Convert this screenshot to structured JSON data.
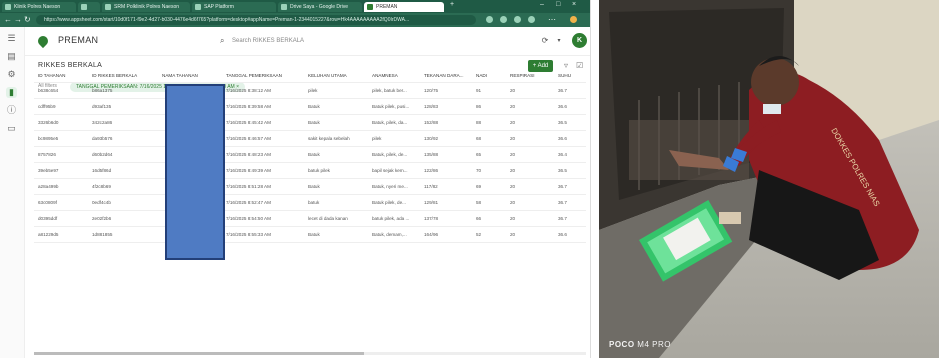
{
  "browser": {
    "tabs": [
      {
        "label": "Klinik Polres Naeson"
      },
      {
        "label": ""
      },
      {
        "label": "SRM Polklinik Polres Naeson"
      },
      {
        "label": "SAP Platform"
      },
      {
        "label": "Drive Saya - Google Drive"
      },
      {
        "label": "PREMAN"
      }
    ],
    "url": "https://www.appsheet.com/start/10d0f171-f9e2-4d27-b030-4476e4d6f765?platform=desktop#appName=Preman-1-2344015227&row=Hk4AAAAAAAAA2fQ0IrDWA...",
    "add_tab": "+",
    "win_controls": [
      "–",
      "□",
      "×"
    ]
  },
  "app": {
    "name": "PREMAN",
    "search_placeholder": "Search RIKKES BERKALA",
    "avatar_initial": "K",
    "page_title": "RIKKES BERKALA",
    "add_label": "+ Add",
    "all_filters": "All filters",
    "filter_chip": "TANGGAL PEMERIKSAAN: 7/16/2025 12:00 AM – 7/17/2025 12:00 AM  ×",
    "columns": [
      "ID TAHANAN",
      "ID RIKKES BERKALA",
      "NAMA TAHANAN",
      "TANGGAL PEMERIKSAAN",
      "KELUHAN UTAMA",
      "ANAMNESA",
      "TEKANAN DARA...",
      "NADI",
      "RESPIRASI",
      "SUHU"
    ],
    "rows": [
      [
        "b638c654",
        "b86a1375",
        "",
        "7/16/2025 8:38:12 AM",
        "pilek",
        "pilek, batuk ber...",
        "120/75",
        "91",
        "20",
        "36.7"
      ],
      [
        "cdff95b9",
        "d93af135",
        "",
        "7/16/2025 8:39:58 AM",
        "Batuk",
        "Batuk pilek, pusi...",
        "128/83",
        "86",
        "20",
        "36.6"
      ],
      [
        "3326b6d0",
        "342c2a86",
        "",
        "7/16/2025 8:45:42 AM",
        "Batuk",
        "Batuk, pilek, da...",
        "152/88",
        "88",
        "20",
        "36.5"
      ],
      [
        "bc9895e5",
        "da93b576",
        "",
        "7/16/2025 8:46:57 AM",
        "sakit kepala sebelah",
        "pilek",
        "130/92",
        "68",
        "20",
        "36.6"
      ],
      [
        "8757826",
        "d60b2d64",
        "",
        "7/16/2025 8:48:23 AM",
        "Batuk",
        "Batuk, pilek, de...",
        "135/88",
        "65",
        "20",
        "36.4"
      ],
      [
        "39eb5e97",
        "16d5f86d",
        "",
        "7/16/2025 8:49:39 AM",
        "batuk pilek",
        "bapil sejak kem...",
        "122/86",
        "70",
        "20",
        "36.5"
      ],
      [
        "a28a499b",
        "4f2c8b69",
        "",
        "7/16/2025 8:51:28 AM",
        "Batuk",
        "Batuk, nyeri me...",
        "117/82",
        "69",
        "20",
        "36.7"
      ],
      [
        "63c0809f",
        "0edf4c4b",
        "",
        "7/16/2025 8:52:47 AM",
        "batuk",
        "Batuk pilek, de...",
        "129/81",
        "58",
        "20",
        "36.7"
      ],
      [
        "d0395ddf",
        "2e02f2b6",
        "",
        "7/16/2025 8:54:50 AM",
        "lecet di dada kanan",
        "batuk pilek, ada ...",
        "137/78",
        "66",
        "20",
        "36.7"
      ],
      [
        "a81229d5",
        "1d881855",
        "",
        "7/16/2025 8:55:33 AM",
        "Batuk",
        "Batuk, demam,...",
        "164/96",
        "52",
        "20",
        "36.6"
      ]
    ]
  },
  "photo": {
    "caption_brand": "POCO",
    "caption_model": "M4 PRO",
    "shirt_text": "DOKKES POLRES NIAS"
  }
}
